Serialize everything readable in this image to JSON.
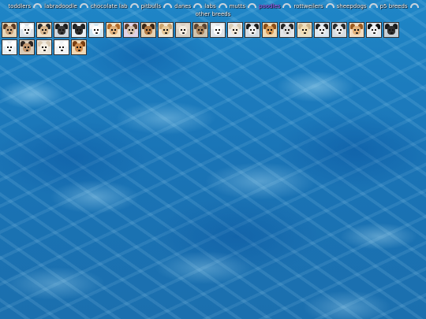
{
  "nav": {
    "links": [
      {
        "label": "toddlers"
      },
      {
        "label": "labradoodle"
      },
      {
        "label": "chocolate lab"
      },
      {
        "label": "pitbulls"
      },
      {
        "label": "danes"
      },
      {
        "label": "labs"
      },
      {
        "label": "mutts"
      },
      {
        "label": "poodles",
        "current": true
      },
      {
        "label": "rottweilers"
      },
      {
        "label": "sheepdogs"
      },
      {
        "label": "p5 breeds"
      },
      {
        "label": "other breeds"
      }
    ],
    "current_color": "#b35bff"
  },
  "dogs": [
    {
      "name": "dog-icon",
      "bg": "#e8d6b8",
      "fur": "#5a3a22",
      "face": "#c9a27a"
    },
    {
      "name": "dog-icon",
      "bg": "#d9e2ea",
      "fur": "#ffffff",
      "face": "#f2f2f2"
    },
    {
      "name": "dog-icon",
      "bg": "#efe0c8",
      "fur": "#2b2b2b",
      "face": "#d7b48a"
    },
    {
      "name": "dog-icon",
      "bg": "#cfd6dc",
      "fur": "#1b1b1b",
      "face": "#3a3a3a"
    },
    {
      "name": "dog-icon",
      "bg": "#e9eef2",
      "fur": "#232323",
      "face": "#2e2e2e"
    },
    {
      "name": "dog-icon",
      "bg": "#cfe6f2",
      "fur": "#f4f4f4",
      "face": "#ffffff"
    },
    {
      "name": "dog-icon",
      "bg": "#f5e2c2",
      "fur": "#b26a28",
      "face": "#e0b07a"
    },
    {
      "name": "dog-icon",
      "bg": "#dfd2e6",
      "fur": "#5c3e2b",
      "face": "#d7c2b0"
    },
    {
      "name": "dog-icon",
      "bg": "#e4d0b2",
      "fur": "#3a2616",
      "face": "#b47a44"
    },
    {
      "name": "dog-icon",
      "bg": "#efe6d4",
      "fur": "#caa46e",
      "face": "#e6c898"
    },
    {
      "name": "dog-icon",
      "bg": "#d8d0c4",
      "fur": "#e6dccf",
      "face": "#f4ece0"
    },
    {
      "name": "dog-icon",
      "bg": "#cfc3ad",
      "fur": "#5b4330",
      "face": "#a37e58"
    },
    {
      "name": "dog-icon",
      "bg": "#dde3e8",
      "fur": "#f2f2f2",
      "face": "#ffffff"
    },
    {
      "name": "dog-icon",
      "bg": "#e8ecef",
      "fur": "#d9cdb6",
      "face": "#f1e8d8"
    },
    {
      "name": "dog-icon",
      "bg": "#d3dbe2",
      "fur": "#1d1d1d",
      "face": "#efefef"
    },
    {
      "name": "dog-icon",
      "bg": "#f0d8b0",
      "fur": "#8a4d16",
      "face": "#d99b55"
    },
    {
      "name": "dog-icon",
      "bg": "#e2e5e8",
      "fur": "#262626",
      "face": "#d9d9d9"
    },
    {
      "name": "dog-icon",
      "bg": "#e9e0c8",
      "fur": "#cdb58a",
      "face": "#efdcb4"
    },
    {
      "name": "dog-icon",
      "bg": "#dde6ee",
      "fur": "#202020",
      "face": "#ececec"
    },
    {
      "name": "dog-icon",
      "bg": "#d8dde2",
      "fur": "#2a2a2a",
      "face": "#e8e8e8"
    },
    {
      "name": "dog-icon",
      "bg": "#f2dcc0",
      "fur": "#9a5a20",
      "face": "#e4b27a"
    },
    {
      "name": "dog-icon",
      "bg": "#e6ebef",
      "fur": "#151515",
      "face": "#f0f0f0"
    },
    {
      "name": "dog-icon",
      "bg": "#c8d0d6",
      "fur": "#1a1a1a",
      "face": "#303030"
    },
    {
      "name": "dog-icon",
      "bg": "#e8eef2",
      "fur": "#ffffff",
      "face": "#fafafa"
    },
    {
      "name": "dog-icon",
      "bg": "#d9cbb8",
      "fur": "#2c2420",
      "face": "#c49870"
    },
    {
      "name": "dog-icon",
      "bg": "#ece6dc",
      "fur": "#d8c8b0",
      "face": "#f6efe4"
    },
    {
      "name": "dog-icon",
      "bg": "#eef2f5",
      "fur": "#ffffff",
      "face": "#f7f7f7"
    },
    {
      "name": "dog-icon",
      "bg": "#f0d8b4",
      "fur": "#7b3f12",
      "face": "#d08c4e"
    }
  ]
}
